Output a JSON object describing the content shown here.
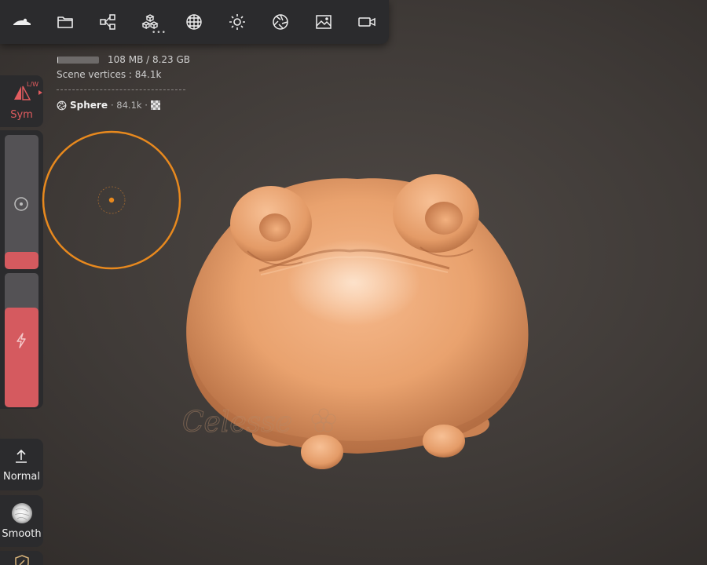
{
  "toolbar": {
    "items": [
      {
        "name": "sculpt-app-icon"
      },
      {
        "name": "folder-icon"
      },
      {
        "name": "scene-graph-icon"
      },
      {
        "name": "mesh-cubes-icon"
      },
      {
        "name": "topology-sphere-icon"
      },
      {
        "name": "light-sun-icon"
      },
      {
        "name": "material-shader-icon"
      },
      {
        "name": "background-image-icon"
      },
      {
        "name": "camera-video-icon"
      }
    ],
    "more_indicator": "•••"
  },
  "info": {
    "memory_text": "108 MB / 8.23 GB",
    "memory_fraction": 0.013,
    "vertices_label": "Scene vertices :",
    "vertices_value": "84.1k",
    "object_name": "Sphere",
    "object_meta": "· 84.1k ·"
  },
  "symmetry": {
    "label": "Sym",
    "mode": "L/W",
    "active_color": "#e25c5f"
  },
  "sliders": {
    "radius_fraction": 0.13,
    "intensity_fraction": 0.74,
    "fill_color": "#d55a5f"
  },
  "buttons": {
    "normal_label": "Normal",
    "smooth_label": "Smooth"
  },
  "cursor": {
    "color": "#e8891e"
  },
  "model": {
    "base_color": "#e7a06e"
  },
  "watermark": {
    "text": "Celesse"
  }
}
